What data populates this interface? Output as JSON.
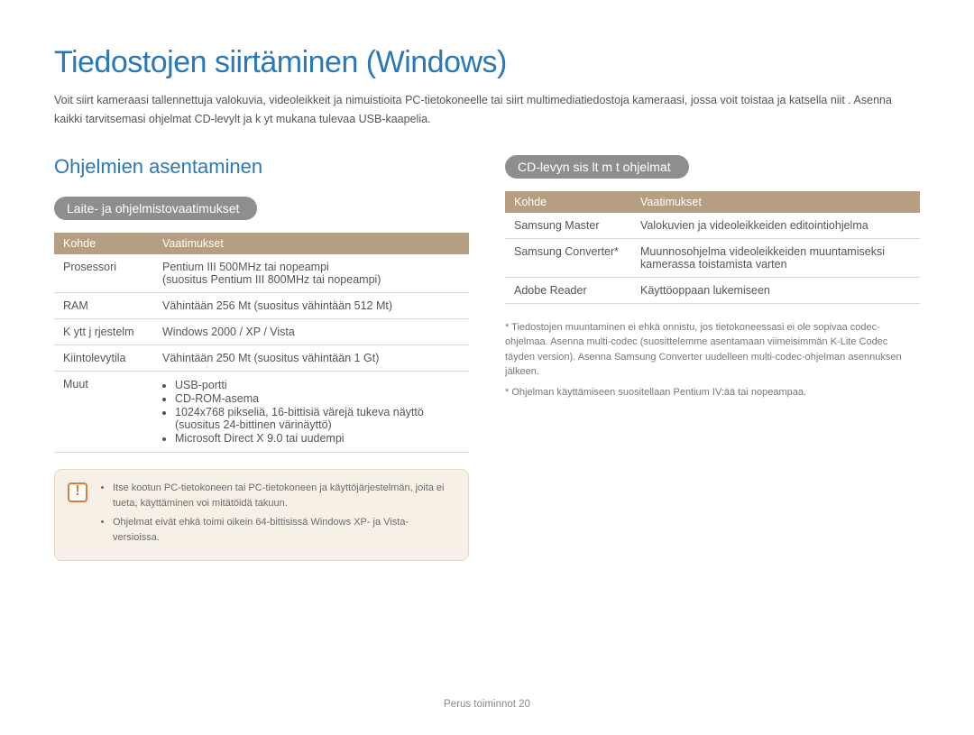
{
  "title": "Tiedostojen siirtäminen (Windows)",
  "intro": "Voit siirt kameraasi tallennettuja valokuvia, videoleikkeit ja nimuistioita PC-tietokoneelle tai siirt multimediatiedostoja kameraasi, jossa voit toistaa ja katsella niit . Asenna kaikki tarvitsemasi ohjelmat CD-levylt ja k yt mukana tulevaa USB-kaapelia.",
  "subhead": "Ohjelmien asentaminen",
  "left": {
    "pill": "Laite- ja ohjelmistovaatimukset",
    "headers": {
      "k": "Kohde",
      "v": "Vaatimukset"
    },
    "rows": {
      "r0": {
        "k": "Prosessori",
        "v0": "Pentium III 500MHz tai nopeampi",
        "v1": "(suositus Pentium III 800MHz tai nopeampi)"
      },
      "r1": {
        "k": "RAM",
        "v": "Vähintään 256 Mt (suositus vähintään 512 Mt)"
      },
      "r2": {
        "k": "K ytt j rjestelm",
        "v": "Windows 2000 / XP / Vista"
      },
      "r3": {
        "k": "Kiintolevytila",
        "v": "Vähintään 250 Mt (suositus vähintään 1 Gt)"
      },
      "r4": {
        "k": "Muut",
        "b0": "USB-portti",
        "b1": "CD-ROM-asema",
        "b2": "1024x768 pikseliä, 16-bittisiä värejä tukeva näyttö (suositus 24-bittinen värinäyttö)",
        "b3": "Microsoft Direct X 9.0 tai uudempi"
      }
    },
    "callout": {
      "b0": "Itse kootun PC-tietokoneen tai PC-tietokoneen ja käyttöjärjestelmän, joita ei tueta, käyttäminen voi mitätöidä takuun.",
      "b1": "Ohjelmat eivät ehkä toimi oikein 64-bittisissä Windows XP- ja Vista-versioissa."
    }
  },
  "right": {
    "pill": "CD-levyn sis lt m t ohjelmat",
    "headers": {
      "k": "Kohde",
      "v": "Vaatimukset"
    },
    "rows": {
      "r0": {
        "k": "Samsung Master",
        "v": "Valokuvien ja videoleikkeiden editointiohjelma"
      },
      "r1": {
        "k": "Samsung Converter*",
        "v": "Muunnosohjelma videoleikkeiden muuntamiseksi kamerassa toistamista varten"
      },
      "r2": {
        "k": "Adobe Reader",
        "v": "Käyttöoppaan lukemiseen"
      }
    },
    "footnotes": {
      "f0": "* Tiedostojen muuntaminen ei ehkä onnistu, jos tietokoneessasi ei ole sopivaa codec-ohjelmaa. Asenna multi-codec (suosittelemme asentamaan viimeisimmän K-Lite Codec täyden version). Asenna Samsung Converter uudelleen multi-codec-ohjelman asennuksen jälkeen.",
      "f1": "* Ohjelman käyttämiseen suositellaan Pentium IV:ää tai nopeampaa."
    }
  },
  "footer": {
    "label": "Perus toiminnot",
    "page": "20"
  }
}
